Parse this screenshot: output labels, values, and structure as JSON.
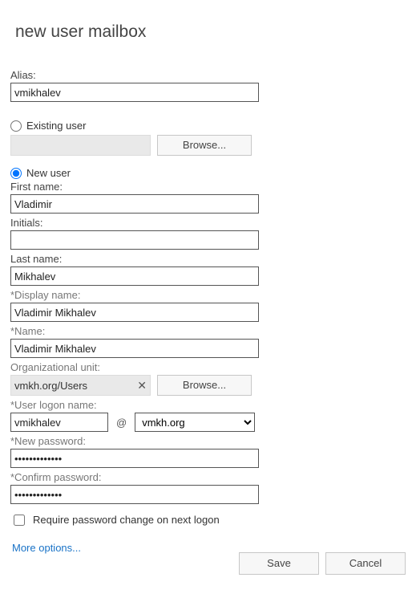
{
  "title": "new user mailbox",
  "alias": {
    "label": "Alias:",
    "value": "vmikhalev"
  },
  "userType": {
    "existing": {
      "label": "Existing user",
      "selected": false,
      "browse": "Browse..."
    },
    "newUser": {
      "label": "New user",
      "selected": true
    }
  },
  "firstName": {
    "label": "First name:",
    "value": "Vladimir"
  },
  "initials": {
    "label": "Initials:",
    "value": ""
  },
  "lastName": {
    "label": "Last name:",
    "value": "Mikhalev"
  },
  "displayName": {
    "label": "*Display name:",
    "value": "Vladimir Mikhalev"
  },
  "name": {
    "label": "*Name:",
    "value": "Vladimir Mikhalev"
  },
  "orgUnit": {
    "label": "Organizational unit:",
    "value": "vmkh.org/Users",
    "browse": "Browse..."
  },
  "logon": {
    "label": "*User logon name:",
    "value": "vmikhalev",
    "at": "@",
    "domain": "vmkh.org"
  },
  "newPassword": {
    "label": "*New password:",
    "value": "•••••••••••••"
  },
  "confirmPassword": {
    "label": "*Confirm password:",
    "value": "•••••••••••••"
  },
  "requireChange": {
    "label": "Require password change on next logon",
    "checked": false
  },
  "moreOptions": "More options...",
  "actions": {
    "save": "Save",
    "cancel": "Cancel"
  }
}
